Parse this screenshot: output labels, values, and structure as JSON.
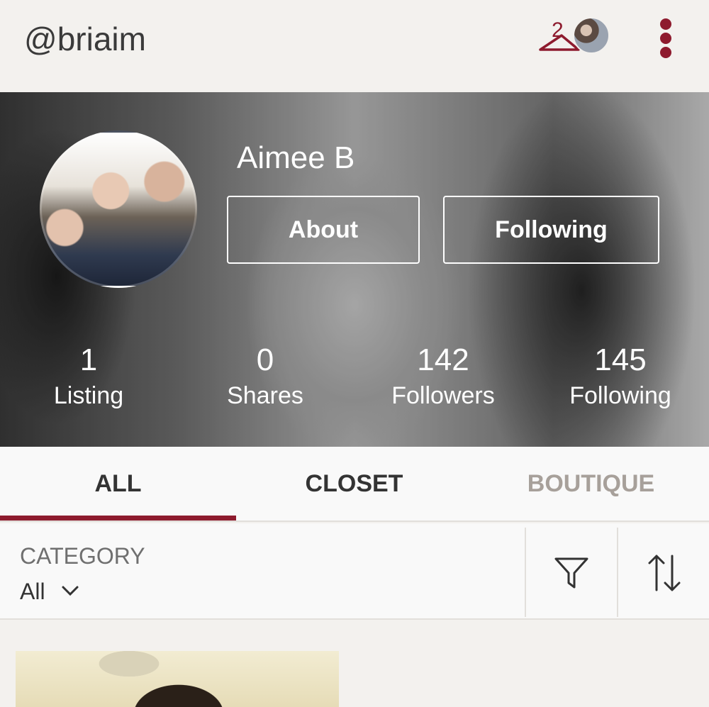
{
  "header": {
    "username": "@briaim",
    "closet_badge_count": "2",
    "icons": [
      "hanger-icon",
      "avatar-icon",
      "more-vert-icon"
    ],
    "accent_color": "#8e1b2e"
  },
  "profile": {
    "display_name": "Aimee B",
    "about_label": "About",
    "following_button_label": "Following"
  },
  "stats": [
    {
      "value": "1",
      "label": "Listing"
    },
    {
      "value": "0",
      "label": "Shares"
    },
    {
      "value": "142",
      "label": "Followers"
    },
    {
      "value": "145",
      "label": "Following"
    }
  ],
  "tabs": [
    {
      "label": "ALL",
      "active": true
    },
    {
      "label": "CLOSET",
      "active": false
    },
    {
      "label": "BOUTIQUE",
      "active": false
    }
  ],
  "filter": {
    "category_label": "CATEGORY",
    "category_value": "All",
    "icons": [
      "filter-icon",
      "sort-icon",
      "chevron-down-icon"
    ]
  }
}
